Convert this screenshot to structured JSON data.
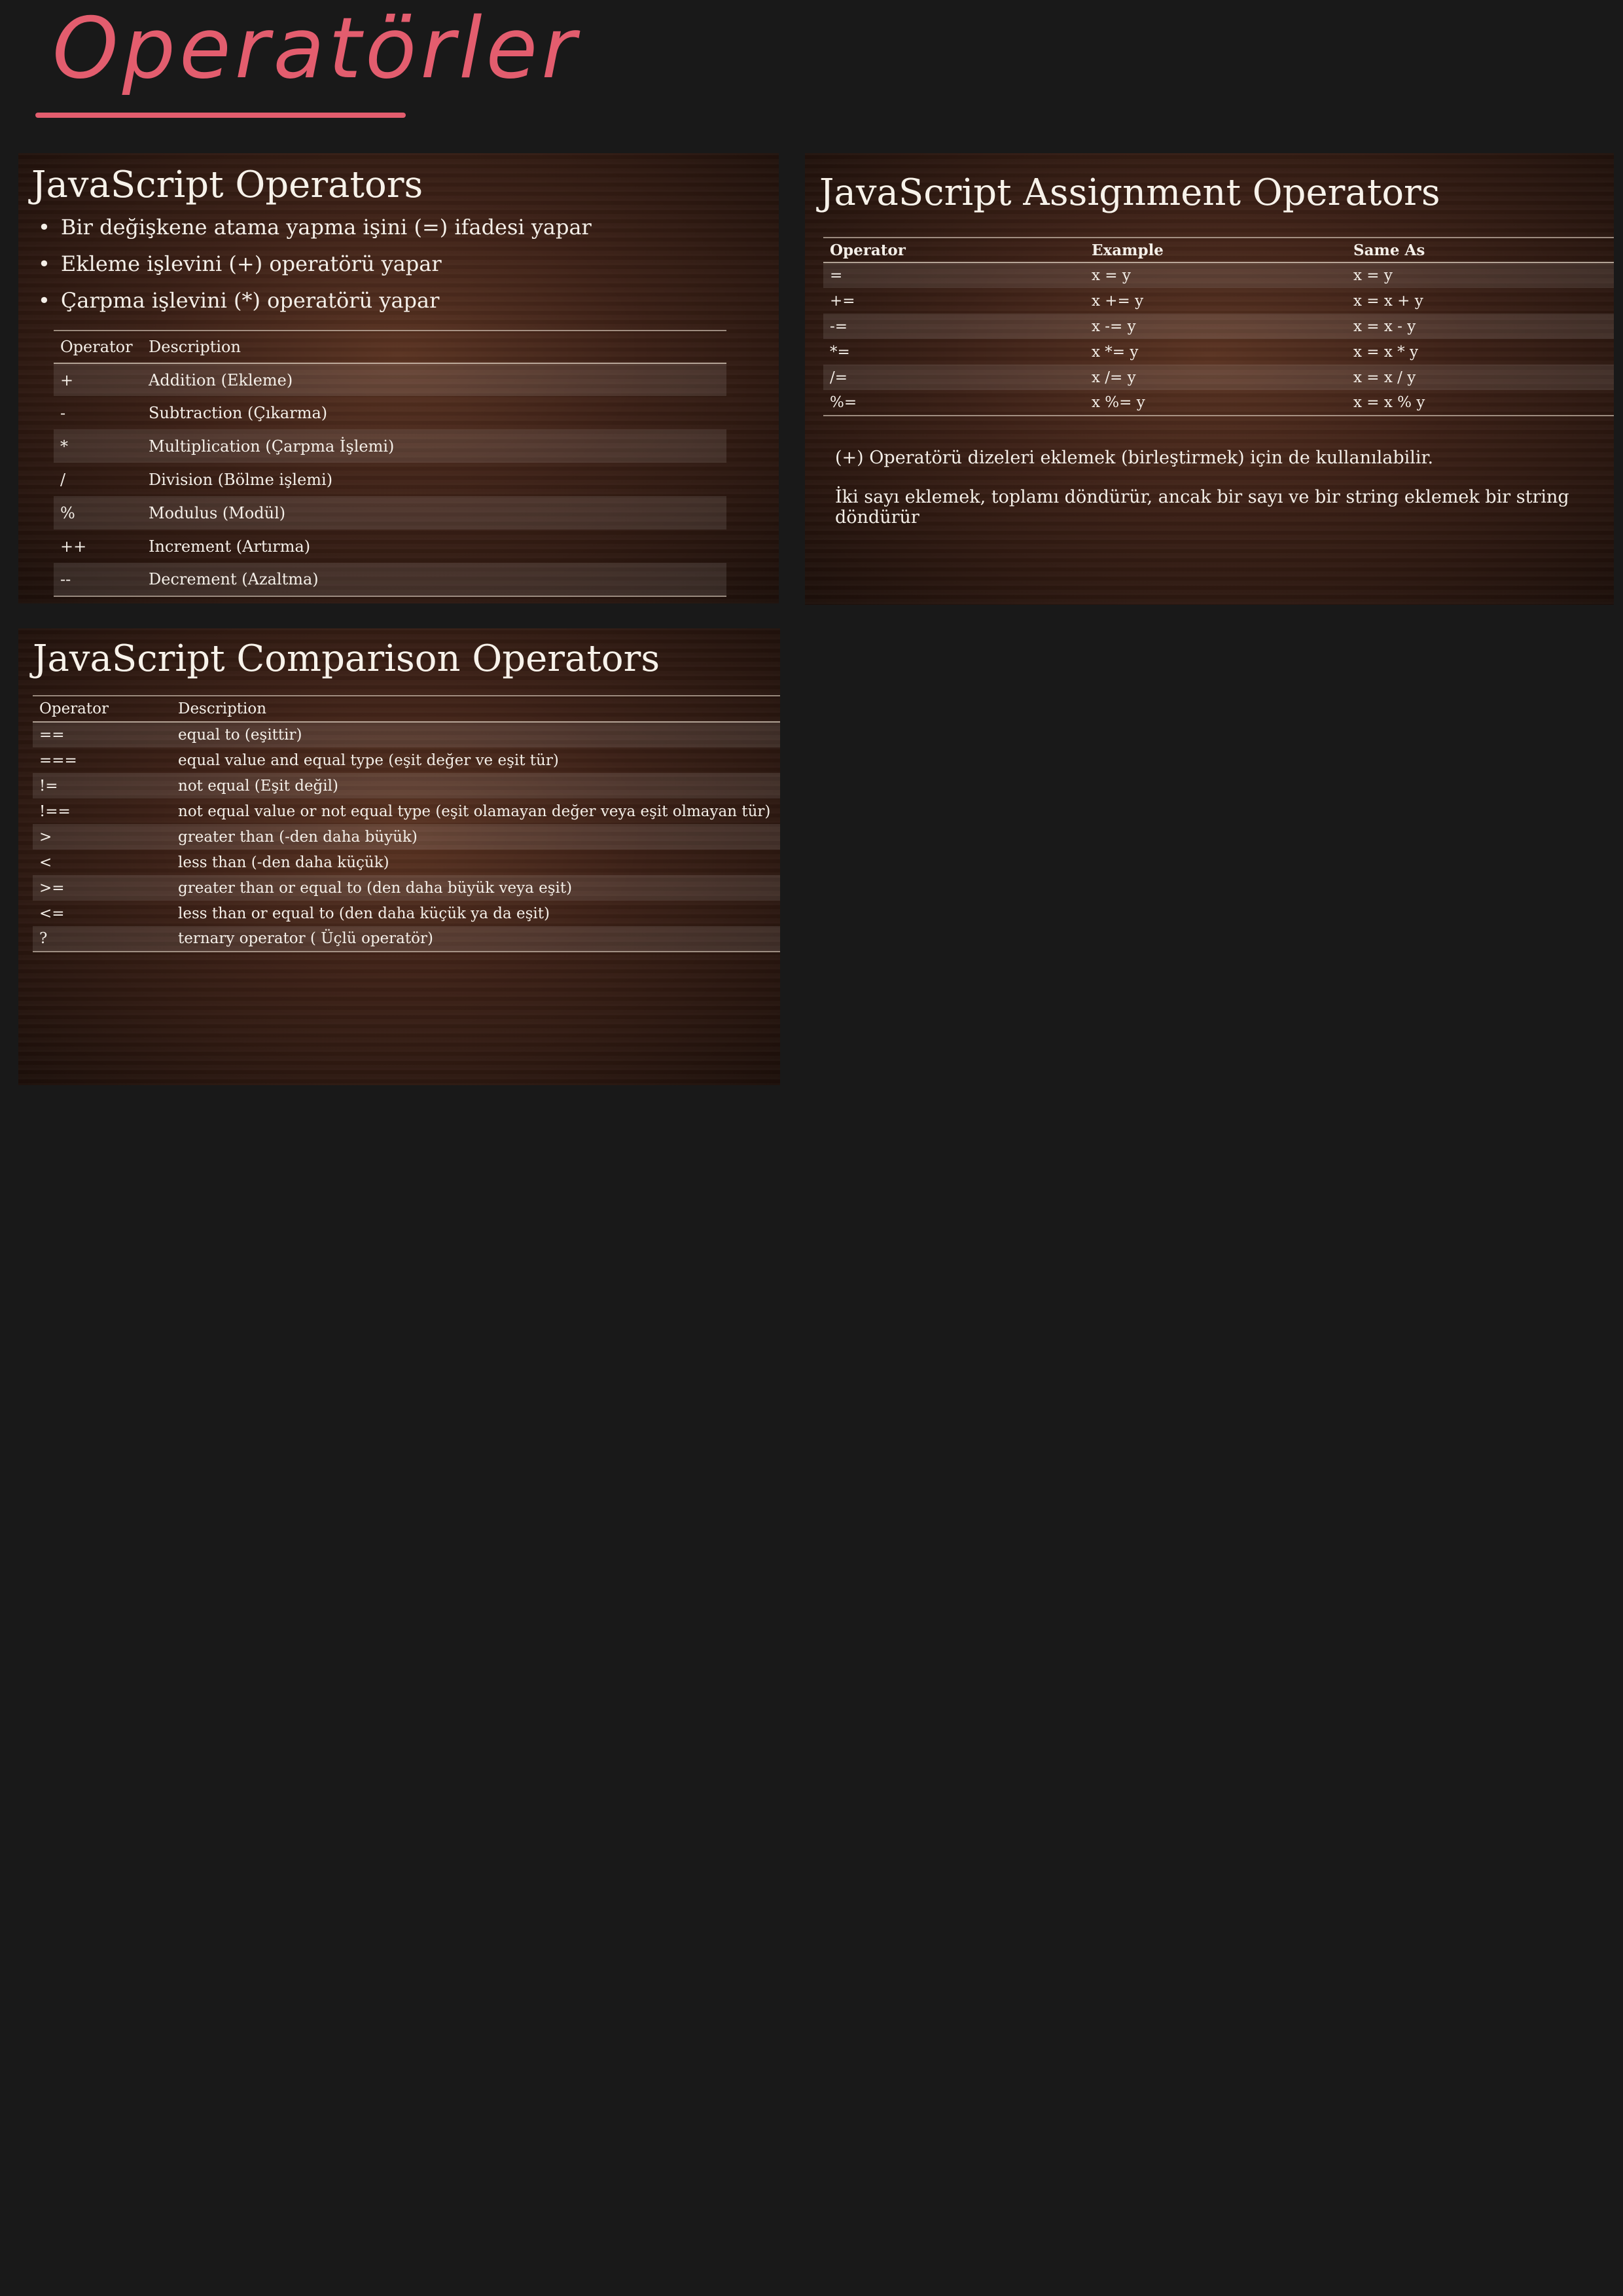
{
  "page_title": "Operatörler",
  "slide1": {
    "heading": "JavaScript Operators",
    "bullets": [
      "Bir değişkene atama yapma işini (=) ifadesi yapar",
      "Ekleme işlevini (+) operatörü yapar",
      "Çarpma işlevini (*) operatörü yapar"
    ],
    "headers": [
      "Operator",
      "Description"
    ],
    "rows": [
      [
        "+",
        "Addition (Ekleme)"
      ],
      [
        "-",
        "Subtraction (Çıkarma)"
      ],
      [
        "*",
        "Multiplication (Çarpma İşlemi)"
      ],
      [
        "/",
        "Division (Bölme işlemi)"
      ],
      [
        "%",
        "Modulus (Modül)"
      ],
      [
        "++",
        "Increment (Artırma)"
      ],
      [
        "--",
        "Decrement (Azaltma)"
      ]
    ]
  },
  "slide2": {
    "heading": "JavaScript Assignment Operators",
    "headers": [
      "Operator",
      "Example",
      "Same As"
    ],
    "rows": [
      [
        "=",
        "x = y",
        "x = y"
      ],
      [
        "+=",
        "x += y",
        "x = x + y"
      ],
      [
        "-=",
        "x -= y",
        "x = x - y"
      ],
      [
        "*=",
        "x *= y",
        "x = x * y"
      ],
      [
        "/=",
        "x /= y",
        "x = x / y"
      ],
      [
        "%=",
        "x %= y",
        "x = x % y"
      ]
    ],
    "notes": [
      "(+) Operatörü dizeleri eklemek (birleştirmek) için de kullanılabilir.",
      "İki sayı eklemek, toplamı döndürür, ancak bir sayı  ve bir string eklemek  bir string döndürür"
    ]
  },
  "slide3": {
    "heading": "JavaScript Comparison Operators",
    "headers": [
      "Operator",
      "Description"
    ],
    "rows": [
      [
        "==",
        "equal to (eşittir)"
      ],
      [
        "===",
        "equal value and equal type (eşit değer ve eşit tür)"
      ],
      [
        "!=",
        "not equal (Eşit değil)"
      ],
      [
        "!==",
        "not equal value or not equal type (eşit olamayan değer veya eşit olmayan tür)"
      ],
      [
        ">",
        "greater than (-den daha büyük)"
      ],
      [
        "<",
        "less than (-den daha küçük)"
      ],
      [
        ">=",
        "greater than or equal to (den daha büyük veya eşit)"
      ],
      [
        "<=",
        "less than or equal to (den daha küçük ya da eşit)"
      ],
      [
        "?",
        "ternary operator ( Üçlü operatör)"
      ]
    ]
  }
}
